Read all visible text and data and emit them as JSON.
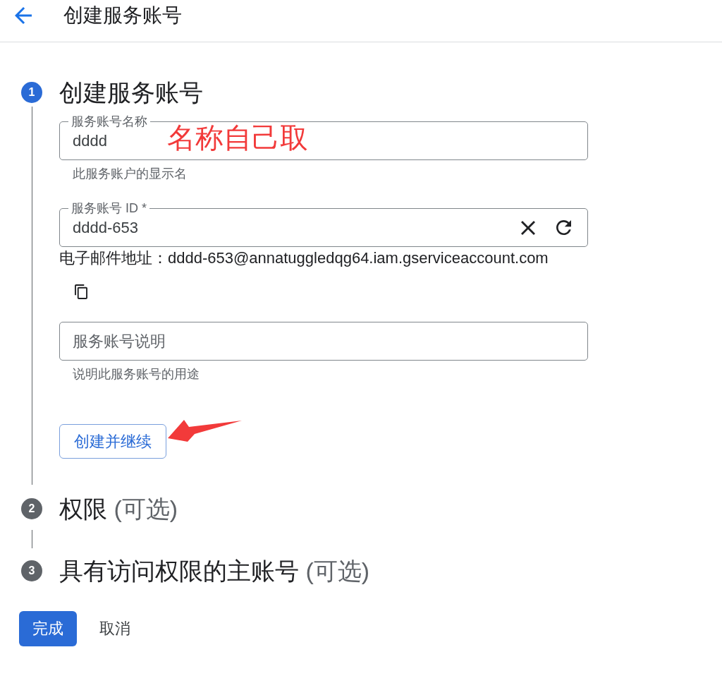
{
  "header": {
    "title": "创建服务账号"
  },
  "steps": [
    {
      "number": "1",
      "title": "创建服务账号",
      "active": true,
      "items": [
        {
          "kind": "field",
          "label": "服务账号名称",
          "value": "dddd",
          "note": "名称自己取",
          "helper": "此服务账户的显示名"
        },
        {
          "kind": "generated_field",
          "label": "服务账号 ID *",
          "value": "dddd-653"
        },
        {
          "kind": "email",
          "text": "电子邮件地址：dddd-653@annatuggledqg64.iam.gserviceaccount.com"
        },
        {
          "kind": "field",
          "placeholder": "服务账号说明",
          "helper": "说明此服务账号的用途"
        },
        {
          "kind": "button",
          "label": "创建并继续",
          "pointer_arrow": true
        }
      ]
    },
    {
      "number": "2",
      "title": "权限",
      "optional": "(可选)",
      "active": false
    },
    {
      "number": "3",
      "title": "具有访问权限的主账号",
      "optional": "(可选)",
      "active": false
    }
  ],
  "actions": [
    {
      "kind": "primary",
      "label": "完成"
    },
    {
      "kind": "text",
      "label": "取消"
    }
  ]
}
